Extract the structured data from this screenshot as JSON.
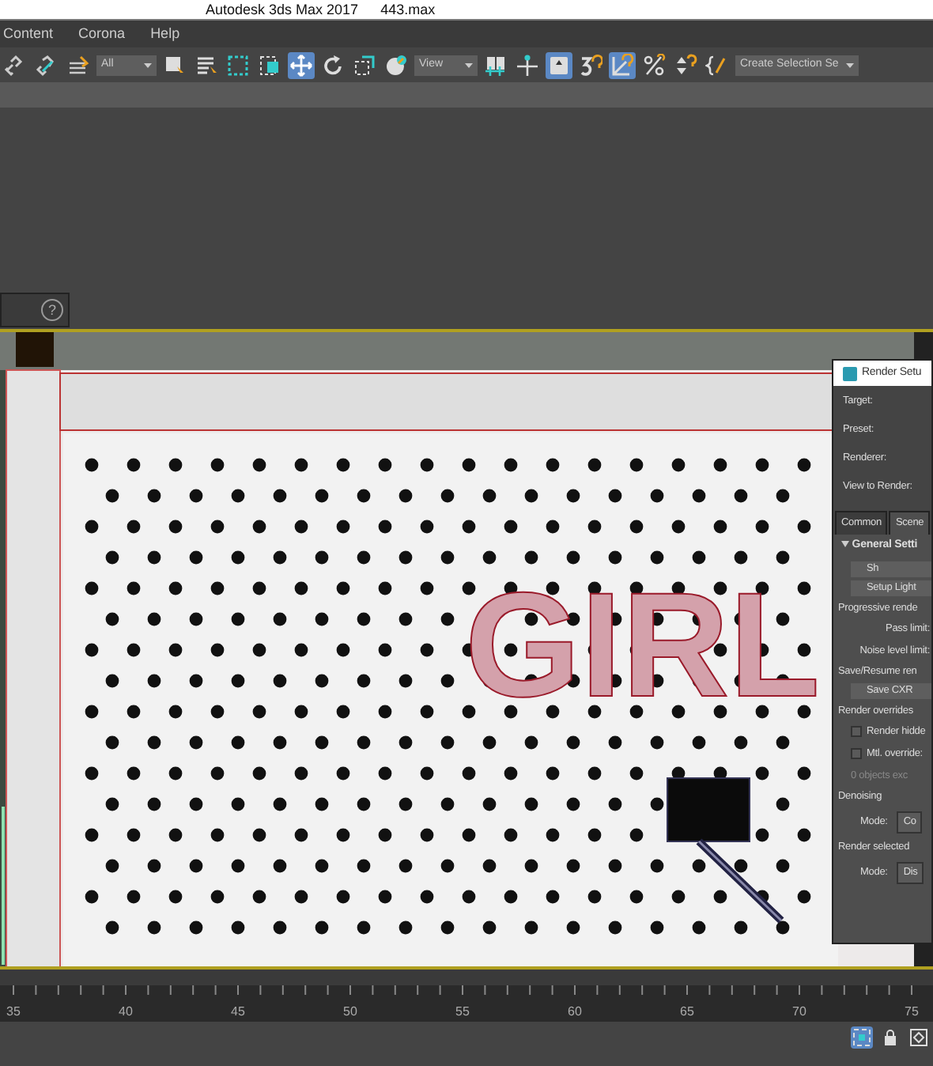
{
  "window": {
    "title": "Autodesk 3ds Max 2017",
    "file": "443.max"
  },
  "menu": [
    "Content",
    "Corona",
    "Help"
  ],
  "toolbar": [
    {
      "kind": "tool",
      "selected": false
    },
    {
      "kind": "tool",
      "selected": false
    },
    {
      "kind": "tool",
      "selected": false
    },
    {
      "kind": "dropdown",
      "value": "All"
    },
    {
      "kind": "tool",
      "selected": false
    },
    {
      "kind": "tool",
      "selected": false
    },
    {
      "kind": "tool",
      "selected": false
    },
    {
      "kind": "tool",
      "selected": false
    },
    {
      "kind": "tool",
      "selected": true
    },
    {
      "kind": "tool",
      "selected": false
    },
    {
      "kind": "tool",
      "selected": false
    },
    {
      "kind": "tool",
      "selected": false
    },
    {
      "kind": "dropdown",
      "value": "View"
    },
    {
      "kind": "tool",
      "selected": false
    },
    {
      "kind": "tool",
      "selected": false
    },
    {
      "kind": "tool",
      "selected": true
    },
    {
      "kind": "tool",
      "selected": false
    },
    {
      "kind": "tool",
      "selected": true
    },
    {
      "kind": "tool",
      "selected": false
    },
    {
      "kind": "tool",
      "selected": false
    },
    {
      "kind": "tool",
      "selected": false
    },
    {
      "kind": "dropdown",
      "value": "Create Selection Se"
    }
  ],
  "help_button": "?",
  "scene_text": "GIRL",
  "render_setup": {
    "title": "Render Setu",
    "fields": [
      "Target:",
      "Preset:",
      "Renderer:",
      "View to Render:"
    ],
    "tabs": [
      {
        "label": "Common",
        "selected": false
      },
      {
        "label": "Scene",
        "selected": true
      }
    ],
    "section": "General Setti",
    "rows": [
      {
        "kind": "button",
        "text": "Sh"
      },
      {
        "kind": "button",
        "text": "Setup Light"
      },
      {
        "kind": "group",
        "text": "Progressive rende"
      },
      {
        "kind": "label",
        "text": "Pass limit:"
      },
      {
        "kind": "label",
        "text": "Noise level limit:"
      },
      {
        "kind": "group",
        "text": "Save/Resume ren"
      },
      {
        "kind": "button",
        "text": "Save CXR"
      },
      {
        "kind": "group",
        "text": "Render overrides"
      },
      {
        "kind": "check",
        "text": "Render hidde",
        "checked": false
      },
      {
        "kind": "check",
        "text": "Mtl. override:",
        "checked": false
      },
      {
        "kind": "disabled",
        "text": "0 objects exc"
      },
      {
        "kind": "group",
        "text": "Denoising"
      },
      {
        "kind": "select",
        "text": "Mode:",
        "value": "Co"
      },
      {
        "kind": "group",
        "text": "Render selected"
      },
      {
        "kind": "select",
        "text": "Mode:",
        "value": "Dis"
      }
    ]
  },
  "timeline": {
    "ticks": [
      "35",
      "40",
      "45",
      "50",
      "55",
      "60",
      "65",
      "70",
      "75"
    ]
  },
  "status_icons": [
    {
      "selected": true
    },
    {
      "selected": false
    },
    {
      "selected": false
    }
  ]
}
